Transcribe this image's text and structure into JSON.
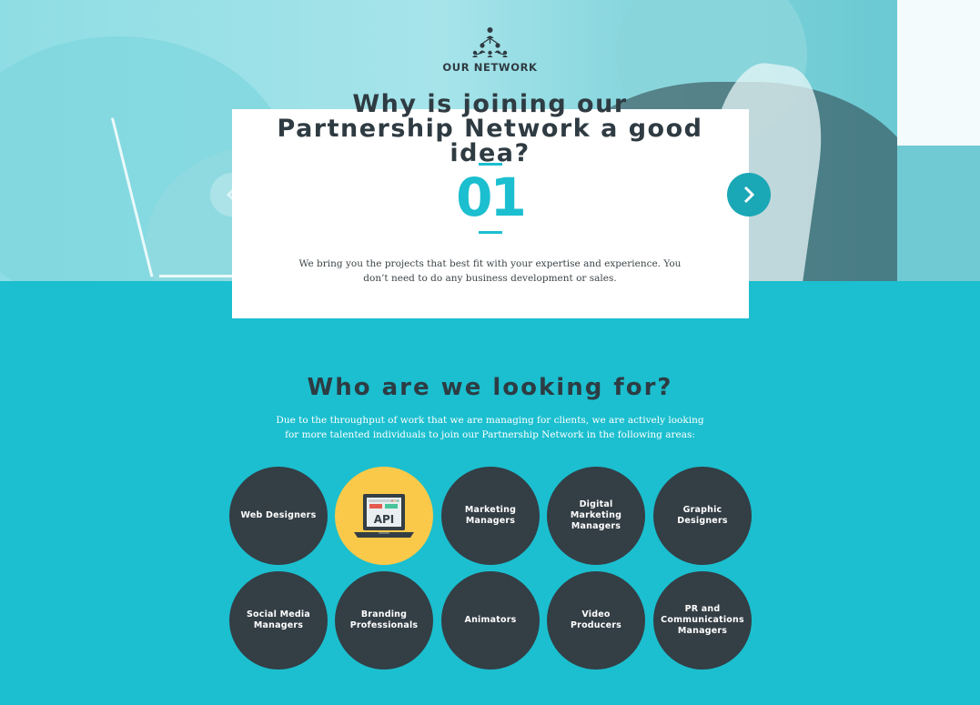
{
  "header": {
    "icon": "network-icon",
    "label": "OUR NETWORK"
  },
  "slider": {
    "title": "Why is joining our Partnership Network a good idea?",
    "number": "01",
    "text": "We bring you the projects that best fit with your expertise and experience. You don’t need to do any business development or sales.",
    "prev_icon": "chevron-left-icon",
    "next_icon": "chevron-right-icon"
  },
  "looking": {
    "title": "Who are we looking for?",
    "text": "Due to the throughput of work that we are managing for clients, we are actively looking for more talented individuals to join our Partnership Network in the following areas:",
    "areas": [
      "Web Designers",
      "API",
      "Marketing Managers",
      "Digital Marketing Managers",
      "Graphic Designers",
      "Social Media Managers",
      "Branding Professionals",
      "Animators",
      "Video Producers",
      "PR and Communications Managers"
    ]
  },
  "colors": {
    "accent": "#1bbfcf",
    "dark": "#343e45",
    "highlight": "#fbc94a"
  }
}
